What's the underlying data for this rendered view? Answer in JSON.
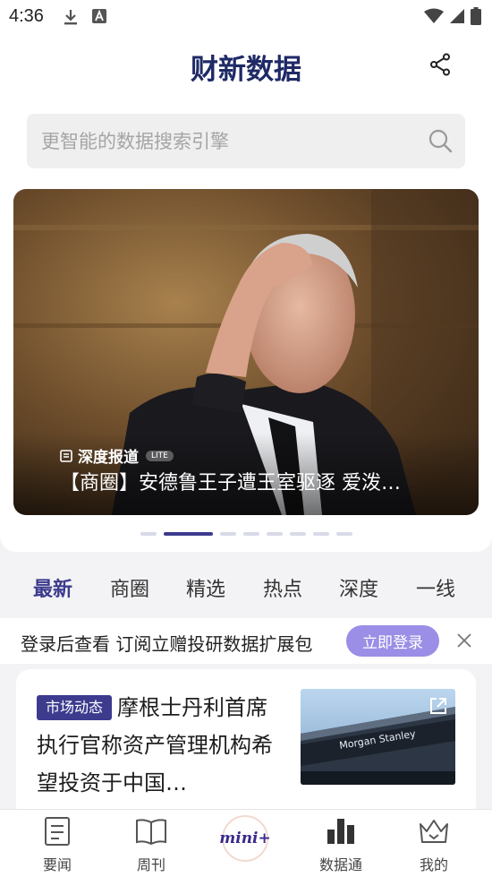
{
  "status_bar": {
    "time": "4:36"
  },
  "header": {
    "logo": "财新数据"
  },
  "search": {
    "placeholder": "更智能的数据搜索引擎"
  },
  "banner": {
    "tag": "深度报道",
    "badge": "LITE",
    "title": "【商圈】安德鲁王子遭王室驱逐 爱泼…",
    "active_index": 1,
    "count": 8
  },
  "tabs": [
    {
      "label": "最新",
      "active": true
    },
    {
      "label": "商圈",
      "active": false
    },
    {
      "label": "精选",
      "active": false
    },
    {
      "label": "热点",
      "active": false
    },
    {
      "label": "深度",
      "active": false
    },
    {
      "label": "一线",
      "active": false
    }
  ],
  "login_prompt": {
    "text": "登录后查看 订阅立赠投研数据扩展包",
    "button": "立即登录"
  },
  "news": [
    {
      "badge": "市场动态",
      "title": "摩根士丹利首席执行官称资产管理机构希望投资于中国…",
      "thumb_text": "Morgan Stanley"
    }
  ],
  "bottom_nav": [
    {
      "label": "要闻",
      "icon": "news-document-icon"
    },
    {
      "label": "周刊",
      "icon": "open-book-icon"
    },
    {
      "label": "mini+",
      "icon": "mini-plus-logo"
    },
    {
      "label": "数据通",
      "icon": "bar-chart-icon"
    },
    {
      "label": "我的",
      "icon": "crown-icon"
    }
  ],
  "colors": {
    "accent": "#3d3b8e",
    "login_button": "#9a8ee6",
    "logo": "#1f2a66"
  }
}
